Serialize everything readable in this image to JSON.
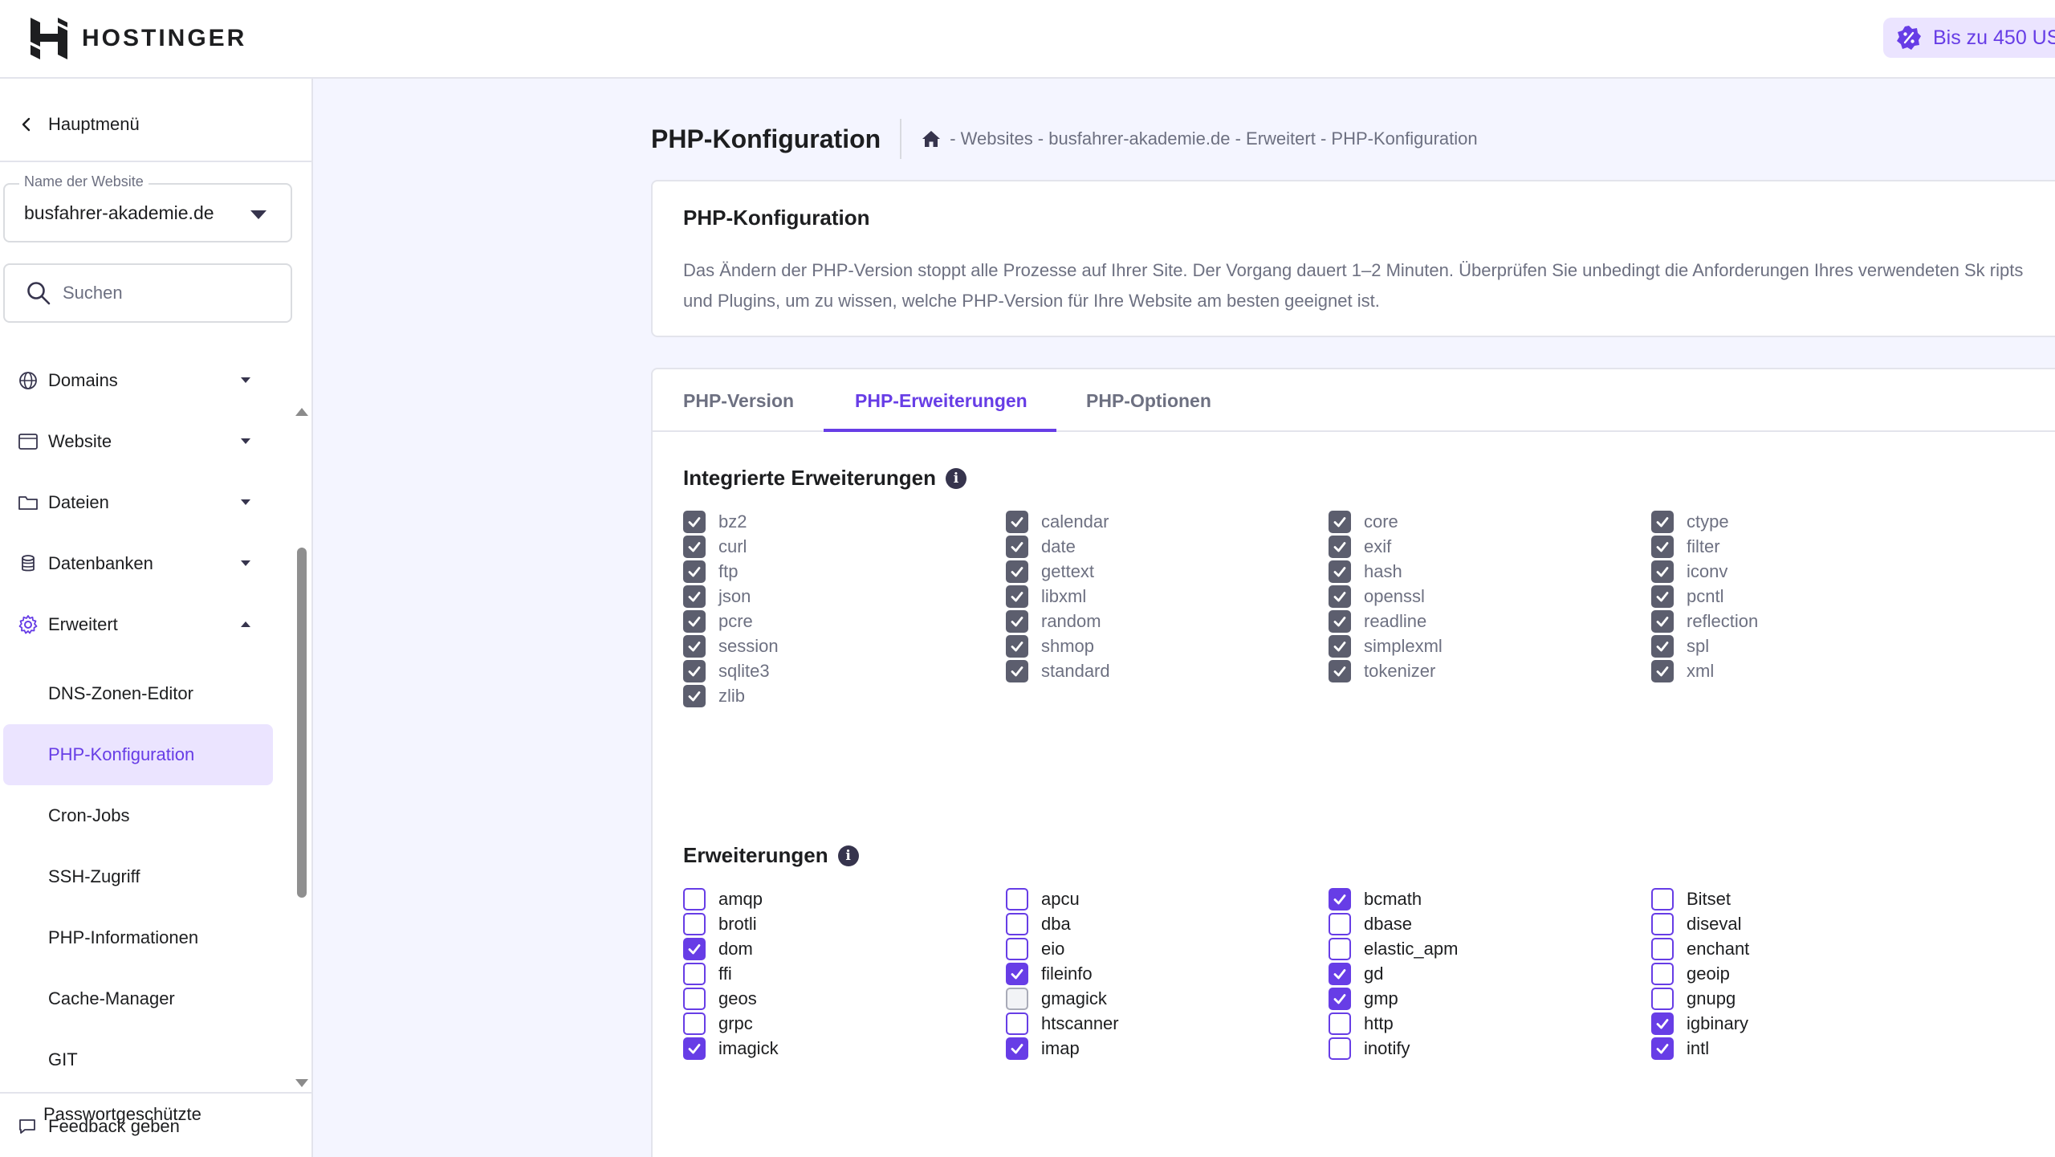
{
  "brand": {
    "name": "HOSTINGER"
  },
  "promo": {
    "text": "Bis zu 450 US"
  },
  "sidebar": {
    "back_label": "Hauptmenü",
    "site_select": {
      "label": "Name der Website",
      "value": "busfahrer-akademie.de"
    },
    "search_placeholder": "Suchen",
    "nav": [
      {
        "label": "Domains",
        "icon": "globe-icon",
        "expanded": false
      },
      {
        "label": "Website",
        "icon": "browser-window-icon",
        "expanded": false
      },
      {
        "label": "Dateien",
        "icon": "folder-icon",
        "expanded": false
      },
      {
        "label": "Datenbanken",
        "icon": "database-icon",
        "expanded": false
      },
      {
        "label": "Erweitert",
        "icon": "gear-icon",
        "expanded": true
      }
    ],
    "sub_items": [
      {
        "label": "DNS-Zonen-Editor",
        "active": false
      },
      {
        "label": "PHP-Konfiguration",
        "active": true
      },
      {
        "label": "Cron-Jobs",
        "active": false
      },
      {
        "label": "SSH-Zugriff",
        "active": false
      },
      {
        "label": "PHP-Informationen",
        "active": false
      },
      {
        "label": "Cache-Manager",
        "active": false
      },
      {
        "label": "GIT",
        "active": false
      },
      {
        "label": "Passwortgeschützte",
        "active": false
      }
    ],
    "feedback_label": "Feedback geben"
  },
  "page": {
    "title": "PHP-Konfiguration",
    "breadcrumb": "- Websites - busfahrer-akademie.de - Erweitert - PHP-Konfiguration"
  },
  "info_card": {
    "title": "PHP-Konfiguration",
    "text": "Das Ändern der PHP-Version stoppt alle Prozesse auf Ihrer Site. Der Vorgang dauert 1–2 Minuten. Überprüfen Sie unbedingt die Anforderungen Ihres verwendeten Sk ripts und Plugins, um zu wissen, welche PHP-Version für Ihre Website am besten geeignet ist."
  },
  "tabs": [
    {
      "label": "PHP-Version",
      "active": false
    },
    {
      "label": "PHP-Erweiterungen",
      "active": true
    },
    {
      "label": "PHP-Optionen",
      "active": false
    }
  ],
  "builtin_section": {
    "title": "Integrierte Erweiterungen",
    "items": [
      "bz2",
      "calendar",
      "core",
      "ctype",
      "curl",
      "date",
      "exif",
      "filter",
      "ftp",
      "gettext",
      "hash",
      "iconv",
      "json",
      "libxml",
      "openssl",
      "pcntl",
      "pcre",
      "random",
      "readline",
      "reflection",
      "session",
      "shmop",
      "simplexml",
      "spl",
      "sqlite3",
      "standard",
      "tokenizer",
      "xml",
      "zlib"
    ]
  },
  "ext_section": {
    "title": "Erweiterungen",
    "items": [
      {
        "name": "amqp",
        "state": "off"
      },
      {
        "name": "apcu",
        "state": "off"
      },
      {
        "name": "bcmath",
        "state": "on"
      },
      {
        "name": "Bitset",
        "state": "off"
      },
      {
        "name": "brotli",
        "state": "off"
      },
      {
        "name": "dba",
        "state": "off"
      },
      {
        "name": "dbase",
        "state": "off"
      },
      {
        "name": "diseval",
        "state": "off"
      },
      {
        "name": "dom",
        "state": "on"
      },
      {
        "name": "eio",
        "state": "off"
      },
      {
        "name": "elastic_apm",
        "state": "off"
      },
      {
        "name": "enchant",
        "state": "off"
      },
      {
        "name": "ffi",
        "state": "off"
      },
      {
        "name": "fileinfo",
        "state": "on"
      },
      {
        "name": "gd",
        "state": "on"
      },
      {
        "name": "geoip",
        "state": "off"
      },
      {
        "name": "geos",
        "state": "off"
      },
      {
        "name": "gmagick",
        "state": "disabled"
      },
      {
        "name": "gmp",
        "state": "on"
      },
      {
        "name": "gnupg",
        "state": "off"
      },
      {
        "name": "grpc",
        "state": "off"
      },
      {
        "name": "htscanner",
        "state": "off"
      },
      {
        "name": "http",
        "state": "off"
      },
      {
        "name": "igbinary",
        "state": "on"
      },
      {
        "name": "imagick",
        "state": "on"
      },
      {
        "name": "imap",
        "state": "on"
      },
      {
        "name": "inotify",
        "state": "off"
      },
      {
        "name": "intl",
        "state": "on"
      }
    ]
  },
  "colors": {
    "accent": "#673de6",
    "builtin_check": "#5c5e6e",
    "text": "#1d1e20",
    "muted": "#6d7081"
  }
}
